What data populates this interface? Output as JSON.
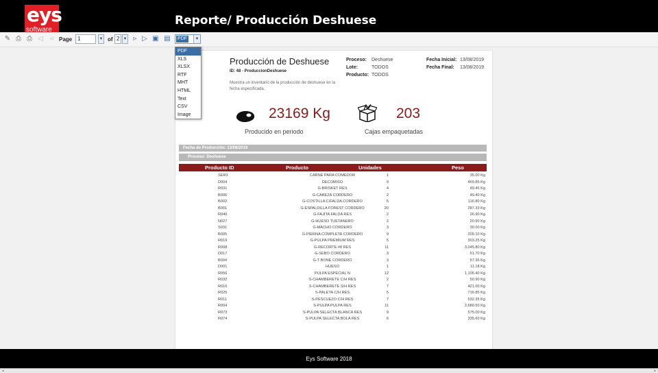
{
  "header": {
    "logo_text": "eys",
    "logo_sub": "software",
    "title": "Reporte/ Producción Deshuese",
    "brand_color": "#e31f26"
  },
  "toolbar": {
    "page_label": "Page",
    "page_value": "1",
    "of_label": "of",
    "page_total": "2",
    "format_selected": "PDF",
    "format_options": [
      "PDF",
      "XLS",
      "XLSX",
      "RTF",
      "MHT",
      "HTML",
      "Text",
      "CSV",
      "Image"
    ]
  },
  "report": {
    "title": "Producción de Deshuese",
    "id_line": "ID: 48 - ProduccionDeshuese",
    "description": "Muestra un inventario de la producción de deshuese en la fecha especificada.",
    "meta": {
      "proceso_label": "Proceso:",
      "proceso_value": "Deshuese",
      "lote_label": "Lote:",
      "lote_value": "TODOS",
      "producto_label": "Producto:",
      "producto_value": "TODOS",
      "fecha_inicial_label": "Fecha Inicial:",
      "fecha_inicial_value": "13/08/2019",
      "fecha_final_label": "Fecha Final:",
      "fecha_final_value": "13/08/2019"
    },
    "kpis": {
      "weight_value": "23169 Kg",
      "weight_label": "Producido en periodo",
      "weight_icon": "meat-icon",
      "boxes_value": "203",
      "boxes_label": "Cajas empaquetadas",
      "boxes_icon": "open-box-icon"
    },
    "group_date": "Fecha de Producción: 13/08/2019",
    "group_process": "Proceso: Deshuese",
    "columns": [
      "Producto ID",
      "Producto",
      "Unidades",
      "Peso"
    ],
    "accent_color": "#8b1a1a",
    "rows": [
      {
        "id": "SER3",
        "producto": "CARNE PARA COMEDOR",
        "unidades": "1",
        "peso": "35.00 Kg"
      },
      {
        "id": "D004",
        "producto": "DECOMISO",
        "unidades": "9",
        "peso": "469.85 Kg"
      },
      {
        "id": "R031",
        "producto": "G-BRISKET RES",
        "unidades": "4",
        "peso": "49.45 Kg"
      },
      {
        "id": "B006",
        "producto": "G-CABEZA CORDERO",
        "unidades": "2",
        "peso": "49.40 Kg"
      },
      {
        "id": "B002",
        "producto": "G-COSTILLA C/FALDA CORDERO",
        "unidades": "5",
        "peso": "116.80 Kg"
      },
      {
        "id": "B001",
        "producto": "G-ESPALDILLA FOREST CORDERO",
        "unidades": "20",
        "peso": "287.33 Kg"
      },
      {
        "id": "R040",
        "producto": "G-FAJITA FALDA RES",
        "unidades": "2",
        "peso": "26.90 Kg"
      },
      {
        "id": "N027",
        "producto": "G-HUESO TUETANERO",
        "unidades": "2",
        "peso": "20.90 Kg"
      },
      {
        "id": "S031",
        "producto": "G-MACHO CORDERO",
        "unidades": "3",
        "peso": "30.00 Kg"
      },
      {
        "id": "B005",
        "producto": "G-PIERNA COMPLETA CORDERO",
        "unidades": "9",
        "peso": "209.10 Kg"
      },
      {
        "id": "R019",
        "producto": "G-PULPA PREMIUM RES",
        "unidades": "5",
        "peso": "303.25 Kg"
      },
      {
        "id": "R008",
        "producto": "G-RECORTE #8 RES",
        "unidades": "11",
        "peso": "3,045.80 Kg"
      },
      {
        "id": "D017",
        "producto": "G-SEBO CORDERO",
        "unidades": "3",
        "peso": "51.70 Kg"
      },
      {
        "id": "B004",
        "producto": "G-T BONE CORDERO",
        "unidades": "3",
        "peso": "57.36 Kg"
      },
      {
        "id": "D001",
        "producto": "HUESO",
        "unidades": "1",
        "peso": "11.18 Kg"
      },
      {
        "id": "R056",
        "producto": "PULPA ESPECIAL N",
        "unidades": "12",
        "peso": "1,105.40 Kg"
      },
      {
        "id": "R032",
        "producto": "S-CHAMBERETE C/H RES",
        "unidades": "2",
        "peso": "50.90 Kg"
      },
      {
        "id": "R016",
        "producto": "S-CHAMBERETE S/H RES",
        "unidades": "7",
        "peso": "421.00 Kg"
      },
      {
        "id": "R025",
        "producto": "S-PALETA C/H RES",
        "unidades": "5",
        "peso": "716.85 Kg"
      },
      {
        "id": "R011",
        "producto": "S-PESCUEZO C/H RES",
        "unidades": "7",
        "peso": "532.35 Kg"
      },
      {
        "id": "R004",
        "producto": "S-PULPA PULPA RES",
        "unidades": "11",
        "peso": "2,680.50 Kg"
      },
      {
        "id": "R073",
        "producto": "S-PULPA SELECTA BLANCA RES",
        "unidades": "9",
        "peso": "575.00 Kg"
      },
      {
        "id": "R074",
        "producto": "S-PULPA SELECTA BOLA RES",
        "unidades": "6",
        "peso": "335.60 Kg"
      }
    ]
  },
  "footer": {
    "text": "Eys Software 2018"
  }
}
